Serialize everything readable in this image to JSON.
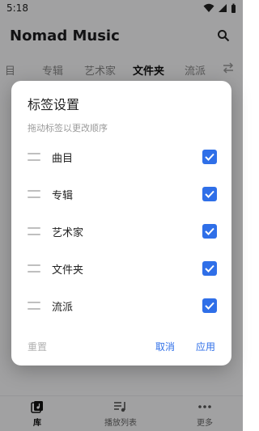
{
  "status_bar": {
    "time": "5:18"
  },
  "app_bar": {
    "title": "Nomad Music",
    "search_icon": "search-icon"
  },
  "tabs": {
    "partial_label": "目",
    "items": [
      {
        "label": "专辑"
      },
      {
        "label": "艺术家"
      },
      {
        "label": "文件夹",
        "active": true
      },
      {
        "label": "流派"
      }
    ],
    "menu_icon": "swap-icon"
  },
  "dialog": {
    "title": "标签设置",
    "subtitle": "拖动标签以更改顺序",
    "items": [
      {
        "label": "曲目",
        "checked": true
      },
      {
        "label": "专辑",
        "checked": true
      },
      {
        "label": "艺术家",
        "checked": true
      },
      {
        "label": "文件夹",
        "checked": true
      },
      {
        "label": "流派",
        "checked": true
      }
    ],
    "reset_label": "重置",
    "cancel_label": "取消",
    "apply_label": "应用"
  },
  "bottom_nav": {
    "items": [
      {
        "label": "库",
        "icon": "library-icon",
        "active": true
      },
      {
        "label": "播放列表",
        "icon": "playlist-icon"
      },
      {
        "label": "更多",
        "icon": "more-icon"
      }
    ]
  },
  "colors": {
    "accent": "#2f6fe8",
    "scrim": "rgba(0,0,0,0.35)"
  }
}
